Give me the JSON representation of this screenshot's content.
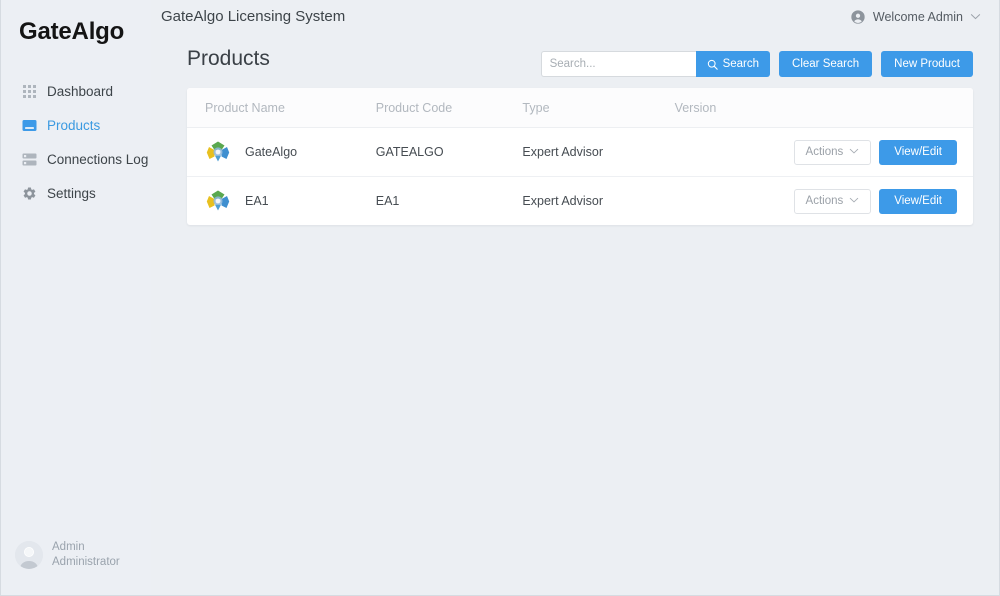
{
  "brand": {
    "name": "GateAlgo"
  },
  "topbar": {
    "title": "GateAlgo Licensing System",
    "welcome_label": "Welcome Admin",
    "user_icon": "user-circle-icon",
    "chevron_icon": "chevron-down-icon"
  },
  "sidebar": {
    "items": [
      {
        "label": "Dashboard",
        "icon": "grid-dots-icon",
        "active": false
      },
      {
        "label": "Products",
        "icon": "box-icon",
        "active": true
      },
      {
        "label": "Connections Log",
        "icon": "server-icon",
        "active": false
      },
      {
        "label": "Settings",
        "icon": "gear-icon",
        "active": false
      }
    ],
    "user": {
      "name": "Admin",
      "role": "Administrator",
      "avatar_icon": "avatar-person-icon"
    }
  },
  "page": {
    "title": "Products"
  },
  "toolbar": {
    "search_placeholder": "Search...",
    "search_value": "",
    "search_button": "Search",
    "search_icon": "search-icon",
    "clear_button": "Clear Search",
    "new_button": "New Product"
  },
  "table": {
    "columns": [
      "Product Name",
      "Product Code",
      "Type",
      "Version",
      ""
    ],
    "rows": [
      {
        "logo": "gatealgo-product-logo",
        "name": "GateAlgo",
        "code": "GATEALGO",
        "type": "Expert Advisor",
        "version": "",
        "actions_label": "Actions",
        "actions_icon": "chevron-down-icon",
        "view_edit_label": "View/Edit"
      },
      {
        "logo": "gatealgo-product-logo",
        "name": "EA1",
        "code": "EA1",
        "type": "Expert Advisor",
        "version": "",
        "actions_label": "Actions",
        "actions_icon": "chevron-down-icon",
        "view_edit_label": "View/Edit"
      }
    ]
  },
  "colors": {
    "accent": "#3d9ae8",
    "sidebar_bg": "#eceff4",
    "page_bg": "#eceff3",
    "card_bg": "#ffffff",
    "text": "#464c52",
    "muted": "#b2b8bf"
  }
}
